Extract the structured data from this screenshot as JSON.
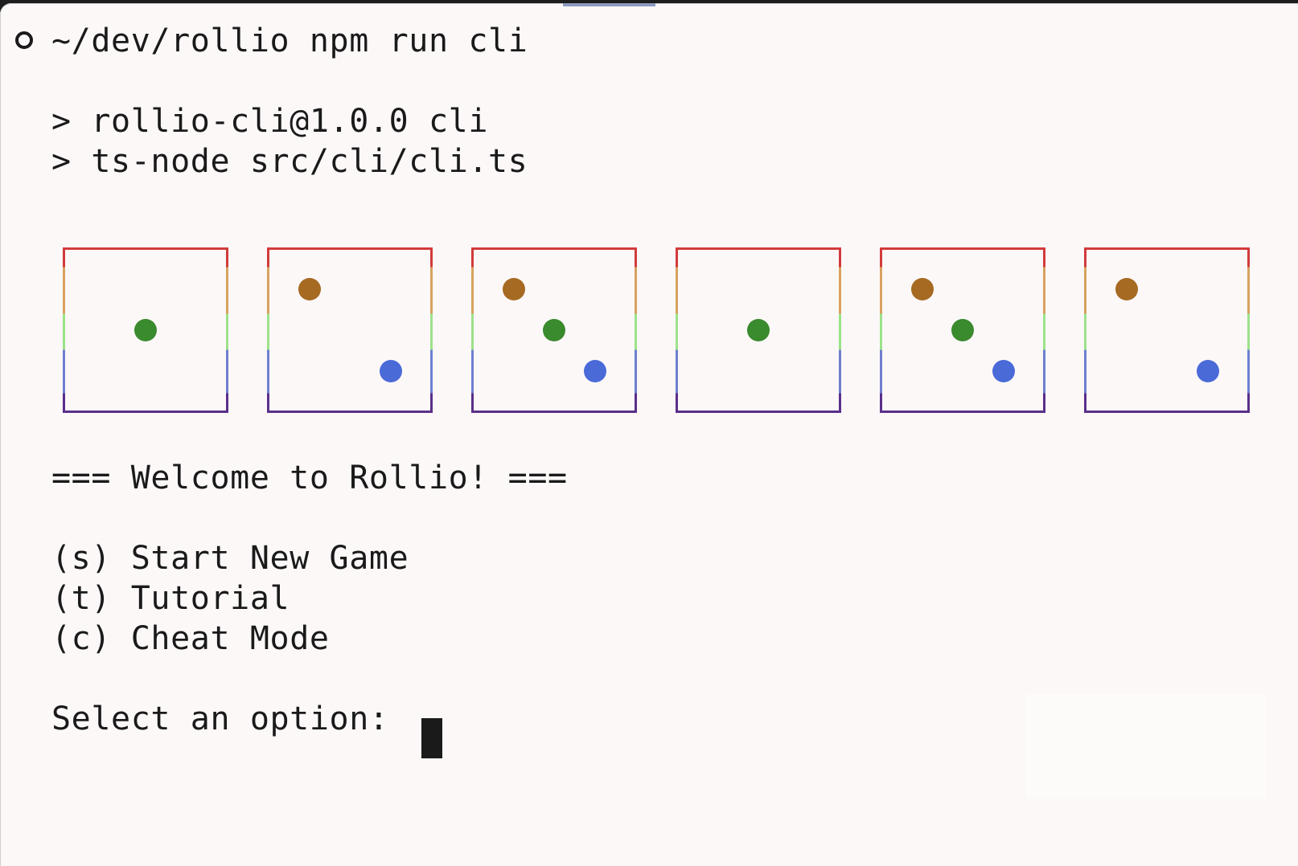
{
  "terminal": {
    "prompt_path": "~/dev/rollio",
    "prompt_command": "npm run cli",
    "npm_lines": [
      "> rollio-cli@1.0.0 cli",
      "> ts-node src/cli/cli.ts"
    ],
    "welcome": "=== Welcome to Rollio! ===",
    "menu": [
      {
        "key": "(s)",
        "label": "Start New Game"
      },
      {
        "key": "(t)",
        "label": "Tutorial"
      },
      {
        "key": "(c)",
        "label": "Cheat Mode"
      }
    ],
    "select_prompt": "Select an option:"
  },
  "dice": [
    {
      "value": 1
    },
    {
      "value": 2
    },
    {
      "value": 3
    },
    {
      "value": 1
    },
    {
      "value": 3
    },
    {
      "value": 2
    }
  ],
  "colors": {
    "pip_top_left": "#a66a22",
    "pip_center": "#3a8a2e",
    "pip_bottom_right": "#4a6ad8",
    "background": "#fcf8f8",
    "text": "#1a1a1a"
  }
}
